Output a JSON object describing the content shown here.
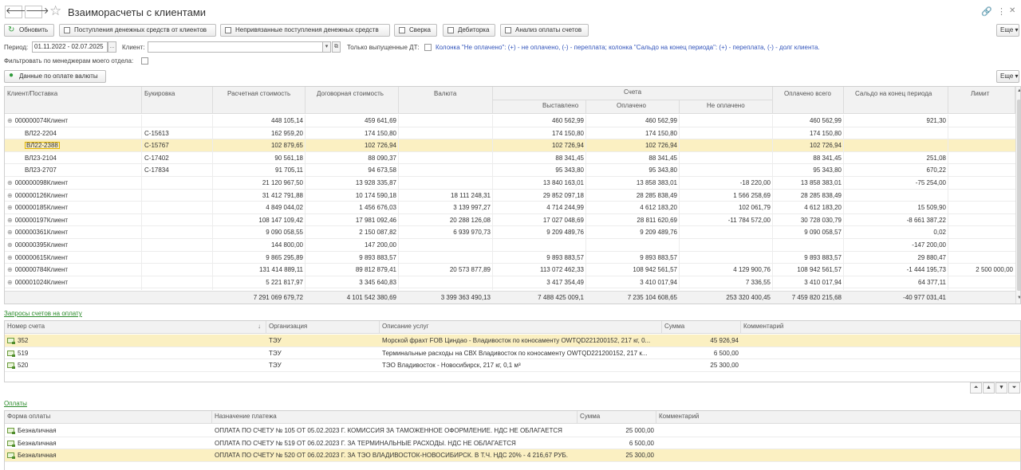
{
  "header": {
    "title": "Взаиморасчеты с клиентами",
    "back_icon": "arrow-left-icon",
    "forward_icon": "arrow-right-icon",
    "more_label": "Еще"
  },
  "toolbar": {
    "refresh": "Обновить",
    "incoming": "Поступления денежных средств от клиентов",
    "unlinked": "Непривязанные поступления денежных средств",
    "reconcile": "Сверка",
    "receivables": "Дебиторка",
    "analysis": "Анализ оплаты счетов"
  },
  "filters": {
    "period_label": "Период:",
    "period_value": "01.11.2022 - 02.07.2025",
    "period_btn": "...",
    "client_label": "Клиент:",
    "client_value": "",
    "only_issued_label": "Только выпущенные ДТ:",
    "note": "Колонка \"Не оплачено\": (+) - не оплачено, (-) - переплата; колонка \"Сальдо на конец периода\": (+) - переплата, (-) - долг клиента.",
    "managers_label": "Фильтровать по менеджерам моего отдела:",
    "currency_btn": "Данные по оплате валюты"
  },
  "main_grid": {
    "headers": {
      "client": "Клиент/Поставка",
      "booking": "Букировка",
      "calc": "Расчетная стоимость",
      "contract": "Договорная стоимость",
      "currency": "Валюта",
      "invoices": "Счета",
      "issued": "Выставлено",
      "paid": "Оплачено",
      "unpaid": "Не оплачено",
      "paid_total": "Оплачено всего",
      "balance": "Сальдо на конец периода",
      "limit": "Лимит"
    },
    "rows": [
      {
        "client": "000000074Клиент",
        "booking": "",
        "calc": "448 105,14",
        "contract": "459 641,69",
        "currency": "",
        "issued": "460 562,99",
        "paid": "460 562,99",
        "unpaid": "",
        "paid_total": "460 562,99",
        "balance": "921,30",
        "limit": ""
      },
      {
        "client": "ВЛ22-2204",
        "booking": "С-15613",
        "calc": "162 959,20",
        "contract": "174 150,80",
        "currency": "",
        "issued": "174 150,80",
        "paid": "174 150,80",
        "unpaid": "",
        "paid_total": "174 150,80",
        "balance": "",
        "limit": ""
      },
      {
        "client": "ВЛ22-2388",
        "booking": "С-15767",
        "calc": "102 879,65",
        "contract": "102 726,94",
        "currency": "",
        "issued": "102 726,94",
        "paid": "102 726,94",
        "unpaid": "",
        "paid_total": "102 726,94",
        "balance": "",
        "limit": ""
      },
      {
        "client": "ВЛ23-2104",
        "booking": "С-17402",
        "calc": "90 561,18",
        "contract": "88 090,37",
        "currency": "",
        "issued": "88 341,45",
        "paid": "88 341,45",
        "unpaid": "",
        "paid_total": "88 341,45",
        "balance": "251,08",
        "limit": ""
      },
      {
        "client": "ВЛ23-2707",
        "booking": "С-17834",
        "calc": "91 705,11",
        "contract": "94 673,58",
        "currency": "",
        "issued": "95 343,80",
        "paid": "95 343,80",
        "unpaid": "",
        "paid_total": "95 343,80",
        "balance": "670,22",
        "limit": ""
      },
      {
        "client": "000000098Клиент",
        "booking": "",
        "calc": "21 120 967,50",
        "contract": "13 928 335,87",
        "currency": "",
        "issued": "13 840 163,01",
        "paid": "13 858 383,01",
        "unpaid": "-18 220,00",
        "paid_total": "13 858 383,01",
        "balance": "-75 254,00",
        "limit": ""
      },
      {
        "client": "000000126Клиент",
        "booking": "",
        "calc": "31 412 791,88",
        "contract": "10 174 590,18",
        "currency": "18 111 248,31",
        "issued": "29 852 097,18",
        "paid": "28 285 838,49",
        "unpaid": "1 566 258,69",
        "paid_total": "28 285 838,49",
        "balance": "",
        "limit": ""
      },
      {
        "client": "000000185Клиент",
        "booking": "",
        "calc": "4 849 044,02",
        "contract": "1 456 676,03",
        "currency": "3 139 997,27",
        "issued": "4 714 244,99",
        "paid": "4 612 183,20",
        "unpaid": "102 061,79",
        "paid_total": "4 612 183,20",
        "balance": "15 509,90",
        "limit": ""
      },
      {
        "client": "000000197Клиент",
        "booking": "",
        "calc": "108 147 109,42",
        "contract": "17 981 092,46",
        "currency": "20 288 126,08",
        "issued": "17 027 048,69",
        "paid": "28 811 620,69",
        "unpaid": "-11 784 572,00",
        "paid_total": "30 728 030,79",
        "balance": "-8 661 387,22",
        "limit": ""
      },
      {
        "client": "000000361Клиент",
        "booking": "",
        "calc": "9 090 058,55",
        "contract": "2 150 087,82",
        "currency": "6 939 970,73",
        "issued": "9 209 489,76",
        "paid": "9 209 489,76",
        "unpaid": "",
        "paid_total": "9 090 058,57",
        "balance": "0,02",
        "limit": ""
      },
      {
        "client": "000000395Клиент",
        "booking": "",
        "calc": "144 800,00",
        "contract": "147 200,00",
        "currency": "",
        "issued": "",
        "paid": "",
        "unpaid": "",
        "paid_total": "",
        "balance": "-147 200,00",
        "limit": ""
      },
      {
        "client": "000000615Клиент",
        "booking": "",
        "calc": "9 865 295,89",
        "contract": "9 893 883,57",
        "currency": "",
        "issued": "9 893 883,57",
        "paid": "9 893 883,57",
        "unpaid": "",
        "paid_total": "9 893 883,57",
        "balance": "29 880,47",
        "limit": ""
      },
      {
        "client": "000000784Клиент",
        "booking": "",
        "calc": "131 414 889,11",
        "contract": "89 812 879,41",
        "currency": "20 573 877,89",
        "issued": "113 072 462,33",
        "paid": "108 942 561,57",
        "unpaid": "4 129 900,76",
        "paid_total": "108 942 561,57",
        "balance": "-1 444 195,73",
        "limit": "2 500 000,00"
      },
      {
        "client": "000001024Клиент",
        "booking": "",
        "calc": "5 221 817,97",
        "contract": "3 345 640,83",
        "currency": "",
        "issued": "3 417 354,49",
        "paid": "3 410 017,94",
        "unpaid": "7 336,55",
        "paid_total": "3 410 017,94",
        "balance": "64 377,11",
        "limit": ""
      }
    ],
    "totals": {
      "calc": "7 291 069 679,72",
      "contract": "4 101 542 380,69",
      "currency": "3 399 363 490,13",
      "issued": "7 488 425 009,1",
      "paid": "7 235 104 608,65",
      "unpaid": "253 320 400,45",
      "paid_total": "7 459 820 215,68",
      "balance": "-40 977 031,41"
    }
  },
  "requests": {
    "link": "Запросы счетов на оплату",
    "headers": {
      "number": "Номер счета",
      "org": "Организация",
      "desc": "Описание услуг",
      "sum": "Сумма",
      "comment": "Комментарий"
    },
    "rows": [
      {
        "number": "352",
        "org": "ТЭУ",
        "desc": "Морской фрахт FOB Циндао - Владивосток по коносаменту OWTQD221200152, 217 кг, 0...",
        "sum": "45 926,94",
        "comment": ""
      },
      {
        "number": "519",
        "org": "ТЭУ",
        "desc": "Терминальные расходы на СВХ Владивосток по коносаменту OWTQD221200152, 217 к...",
        "sum": "6 500,00",
        "comment": ""
      },
      {
        "number": "520",
        "org": "ТЭУ",
        "desc": "ТЭО Владивосток - Новосибирск, 217 кг, 0,1 м³",
        "sum": "25 300,00",
        "comment": ""
      }
    ]
  },
  "payments": {
    "link": "Оплаты",
    "headers": {
      "form": "Форма оплаты",
      "purpose": "Назначение платежа",
      "sum": "Сумма",
      "comment": "Комментарий"
    },
    "rows": [
      {
        "form": "Безналичная",
        "purpose": "ОПЛАТА ПО СЧЕТУ № 105 ОТ 05.02.2023 Г. КОМИССИЯ ЗА ТАМОЖЕННОЕ ОФОРМЛЕНИЕ. НДС НЕ ОБЛАГАЕТСЯ",
        "sum": "25 000,00",
        "comment": ""
      },
      {
        "form": "Безналичная",
        "purpose": "ОПЛАТА ПО СЧЕТУ № 519 ОТ 06.02.2023 Г. ЗА ТЕРМИНАЛЬНЫЕ РАСХОДЫ. НДС НЕ ОБЛАГАЕТСЯ",
        "sum": "6 500,00",
        "comment": ""
      },
      {
        "form": "Безналичная",
        "purpose": "ОПЛАТА ПО СЧЕТУ № 520 ОТ 06.02.2023 Г. ЗА ТЭО ВЛАДИВОСТОК-НОВОСИБИРСК. В Т.Ч. НДС 20% - 4 216,67 РУБ.",
        "sum": "25 300,00",
        "comment": ""
      }
    ]
  }
}
